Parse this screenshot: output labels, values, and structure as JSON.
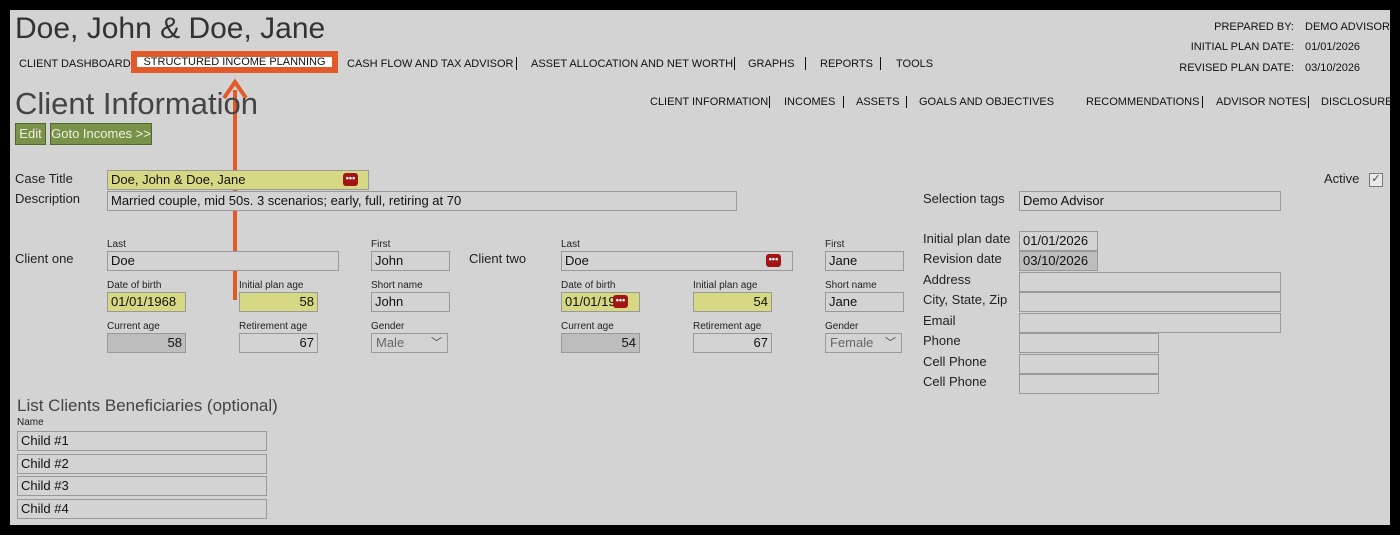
{
  "header": {
    "client_name": "Doe, John & Doe, Jane",
    "prepared_by_label": "PREPARED BY:",
    "prepared_by_value": "DEMO ADVISOR",
    "initial_plan_date_label": "INITIAL PLAN DATE:",
    "initial_plan_date_value": "01/01/2026",
    "revised_plan_date_label": "REVISED PLAN DATE:",
    "revised_plan_date_value": "03/10/2026"
  },
  "main_nav": {
    "client_dashboard": "CLIENT DASHBOARD",
    "structured_income_planning": "STRUCTURED INCOME PLANNING",
    "cash_flow": "CASH FLOW AND TAX ADVISOR",
    "asset_allocation": "ASSET ALLOCATION AND NET WORTH",
    "graphs": "GRAPHS",
    "reports": "REPORTS",
    "tools": "TOOLS"
  },
  "page_title": "Client Information",
  "sub_nav": {
    "client_information": "CLIENT INFORMATION",
    "incomes": "INCOMES",
    "assets": "ASSETS",
    "goals": "GOALS AND OBJECTIVES",
    "recommendations": "RECOMMENDATIONS",
    "advisor_notes": "ADVISOR NOTES",
    "disclosure": "DISCLOSURE"
  },
  "buttons": {
    "edit": "Edit",
    "goto_incomes": "Goto Incomes >>"
  },
  "case": {
    "title_label": "Case Title",
    "title_value": "Doe, John & Doe, Jane",
    "description_label": "Description",
    "description_value": "Married couple, mid 50s. 3 scenarios; early, full, retiring at 70",
    "active_label": "Active",
    "active_checked": true
  },
  "client_one": {
    "label": "Client one",
    "last_label": "Last",
    "last_value": "Doe",
    "first_label": "First",
    "first_value": "John",
    "dob_label": "Date of birth",
    "dob_value": "01/01/1968",
    "initial_plan_age_label": "Initial plan age",
    "initial_plan_age_value": "58",
    "short_name_label": "Short name",
    "short_name_value": "John",
    "current_age_label": "Current age",
    "current_age_value": "58",
    "retirement_age_label": "Retirement age",
    "retirement_age_value": "67",
    "gender_label": "Gender",
    "gender_value": "Male"
  },
  "client_two": {
    "label": "Client two",
    "last_label": "Last",
    "last_value": "Doe",
    "first_label": "First",
    "first_value": "Jane",
    "dob_label": "Date of birth",
    "dob_value": "01/01/19",
    "initial_plan_age_label": "Initial plan age",
    "initial_plan_age_value": "54",
    "short_name_label": "Short name",
    "short_name_value": "Jane",
    "current_age_label": "Current age",
    "current_age_value": "54",
    "retirement_age_label": "Retirement age",
    "retirement_age_value": "67",
    "gender_label": "Gender",
    "gender_value": "Female"
  },
  "right_panel": {
    "selection_tags_label": "Selection tags",
    "selection_tags_value": "Demo Advisor",
    "initial_plan_date_label": "Initial plan date",
    "initial_plan_date_value": "01/01/2026",
    "revision_date_label": "Revision date",
    "revision_date_value": "03/10/2026",
    "address_label": "Address",
    "address_value": "",
    "city_label": "City, State, Zip",
    "city_value": "",
    "email_label": "Email",
    "email_value": "",
    "phone_label": "Phone",
    "phone_value": "",
    "cell_phone_label": "Cell Phone",
    "cell_phone_value": "",
    "cell_phone2_label": "Cell Phone",
    "cell_phone2_value": ""
  },
  "beneficiaries": {
    "title": "List Clients Beneficiaries (optional)",
    "name_label": "Name",
    "items": [
      "Child #1",
      "Child #2",
      "Child #3",
      "Child #4"
    ]
  },
  "icons": {
    "more": "more-dots-icon",
    "chevron": "chevron-down-icon",
    "check": "check-icon",
    "annotation": "annotation-arrow-icon"
  },
  "colors": {
    "highlight": "#e35a2a",
    "button_green": "#78924a",
    "required_yellow": "#d6d883",
    "dots_red": "#a31515"
  }
}
